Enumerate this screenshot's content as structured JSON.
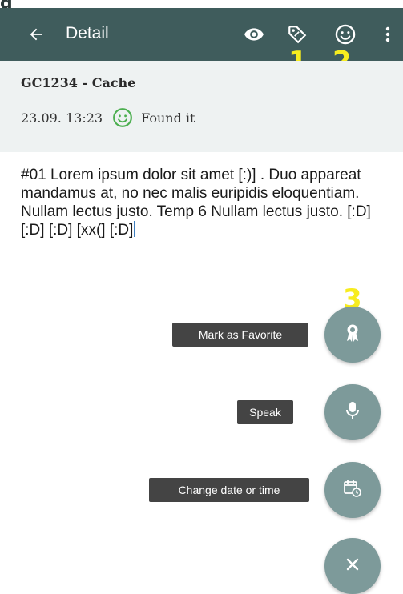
{
  "top_glyph": "g",
  "toolbar": {
    "title": "Detail",
    "back_icon": "arrow-left-icon",
    "actions": [
      "eye-icon",
      "tag-icon",
      "smiley-icon",
      "more-vertical-icon"
    ],
    "background": "#3f5c5c"
  },
  "callouts": {
    "one": "1",
    "two": "2",
    "three": "3"
  },
  "cache": {
    "title": "GC1234 - Cache",
    "log_date": "23.09. 13:23",
    "log_type": "Found it",
    "log_type_icon": "smiley-green-icon"
  },
  "log_text": "#01 Lorem ipsum dolor sit amet [:)] . Duo appareat mandamus at, no nec malis euripidis eloquentiam. Nullam lectus justo. Temp 6 Nullam lectus justo. [:D] [:D] [:D] [xx(] [:D]",
  "fab_menu": {
    "favorite_label": "Mark as Favorite",
    "speak_label": "Speak",
    "date_label": "Change date or time",
    "favorite_icon": "award-ribbon-icon",
    "speak_icon": "microphone-icon",
    "date_icon": "calendar-clock-icon",
    "close_icon": "close-icon",
    "fab_color": "#7d9a9a"
  }
}
